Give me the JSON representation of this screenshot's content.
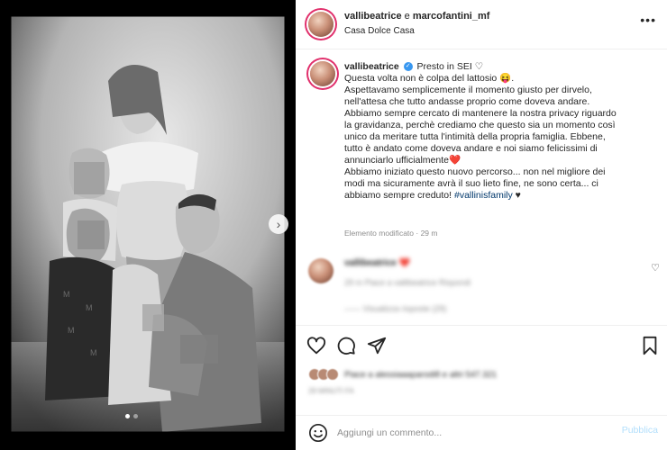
{
  "post": {
    "accounts_joined": "vallibeatrice e marcofantini_mf",
    "user_primary": "vallibeatrice",
    "user_secondary": "marcofantini_mf",
    "joiner": " e ",
    "location": "Casa Dolce Casa"
  },
  "caption": {
    "username": "vallibeatrice",
    "verified_glyph": "✓",
    "text_first": "Presto in SEI ♡\nQuesta volta non è colpa del lattosio 😝.\nAspettavamo semplicemente il momento giusto per dirvelo,\nnell'attesa che tutto andasse proprio come doveva andare.\nAbbiamo sempre cercato di mantenere la nostra privacy riguardo\nla gravidanza, perchè crediamo che questo sia un momento così\nunico da meritare tutta l'intimità della propria famiglia. Ebbene,\ntutto è andato come doveva andare e noi siamo felicissimi di\nannunciarlo ufficialmente❤️\nAbbiamo iniziato questo nuovo percorso... non nel migliore dei\nmodi ma sicuramente avrà il suo lieto fine, ne sono certa... ci\nabbiamo sempre creduto! ",
    "hashtag": "#vallinisfamily",
    "text_end": " ♥",
    "meta": "Elemento modificato · 29 m"
  },
  "comment": {
    "username": "vallibeatrice",
    "text": "❤️",
    "sub": "29 m  Piace a vallibeatrice   Rispondi",
    "replies": "—— Visualizza risposte (29)"
  },
  "actions": {
    "likes_text": "Piace a alessiaaaparodi8 e altri 547.321",
    "date_text": "29 MINUTI FA"
  },
  "comment_bar": {
    "placeholder": "Aggiungi un commento...",
    "publish_label": "Pubblica"
  },
  "colors": {
    "accent_link": "#00376b",
    "verified": "#3897f0",
    "publish_disabled": "#b2dffc",
    "meta_gray": "#8e8e8e"
  },
  "icons": [
    "next-arrow-icon",
    "more-options-icon",
    "heart-icon",
    "comment-icon",
    "share-icon",
    "bookmark-icon",
    "emoji-icon",
    "verified-icon"
  ],
  "carousel": {
    "slides": 2,
    "active_slide": 1
  }
}
